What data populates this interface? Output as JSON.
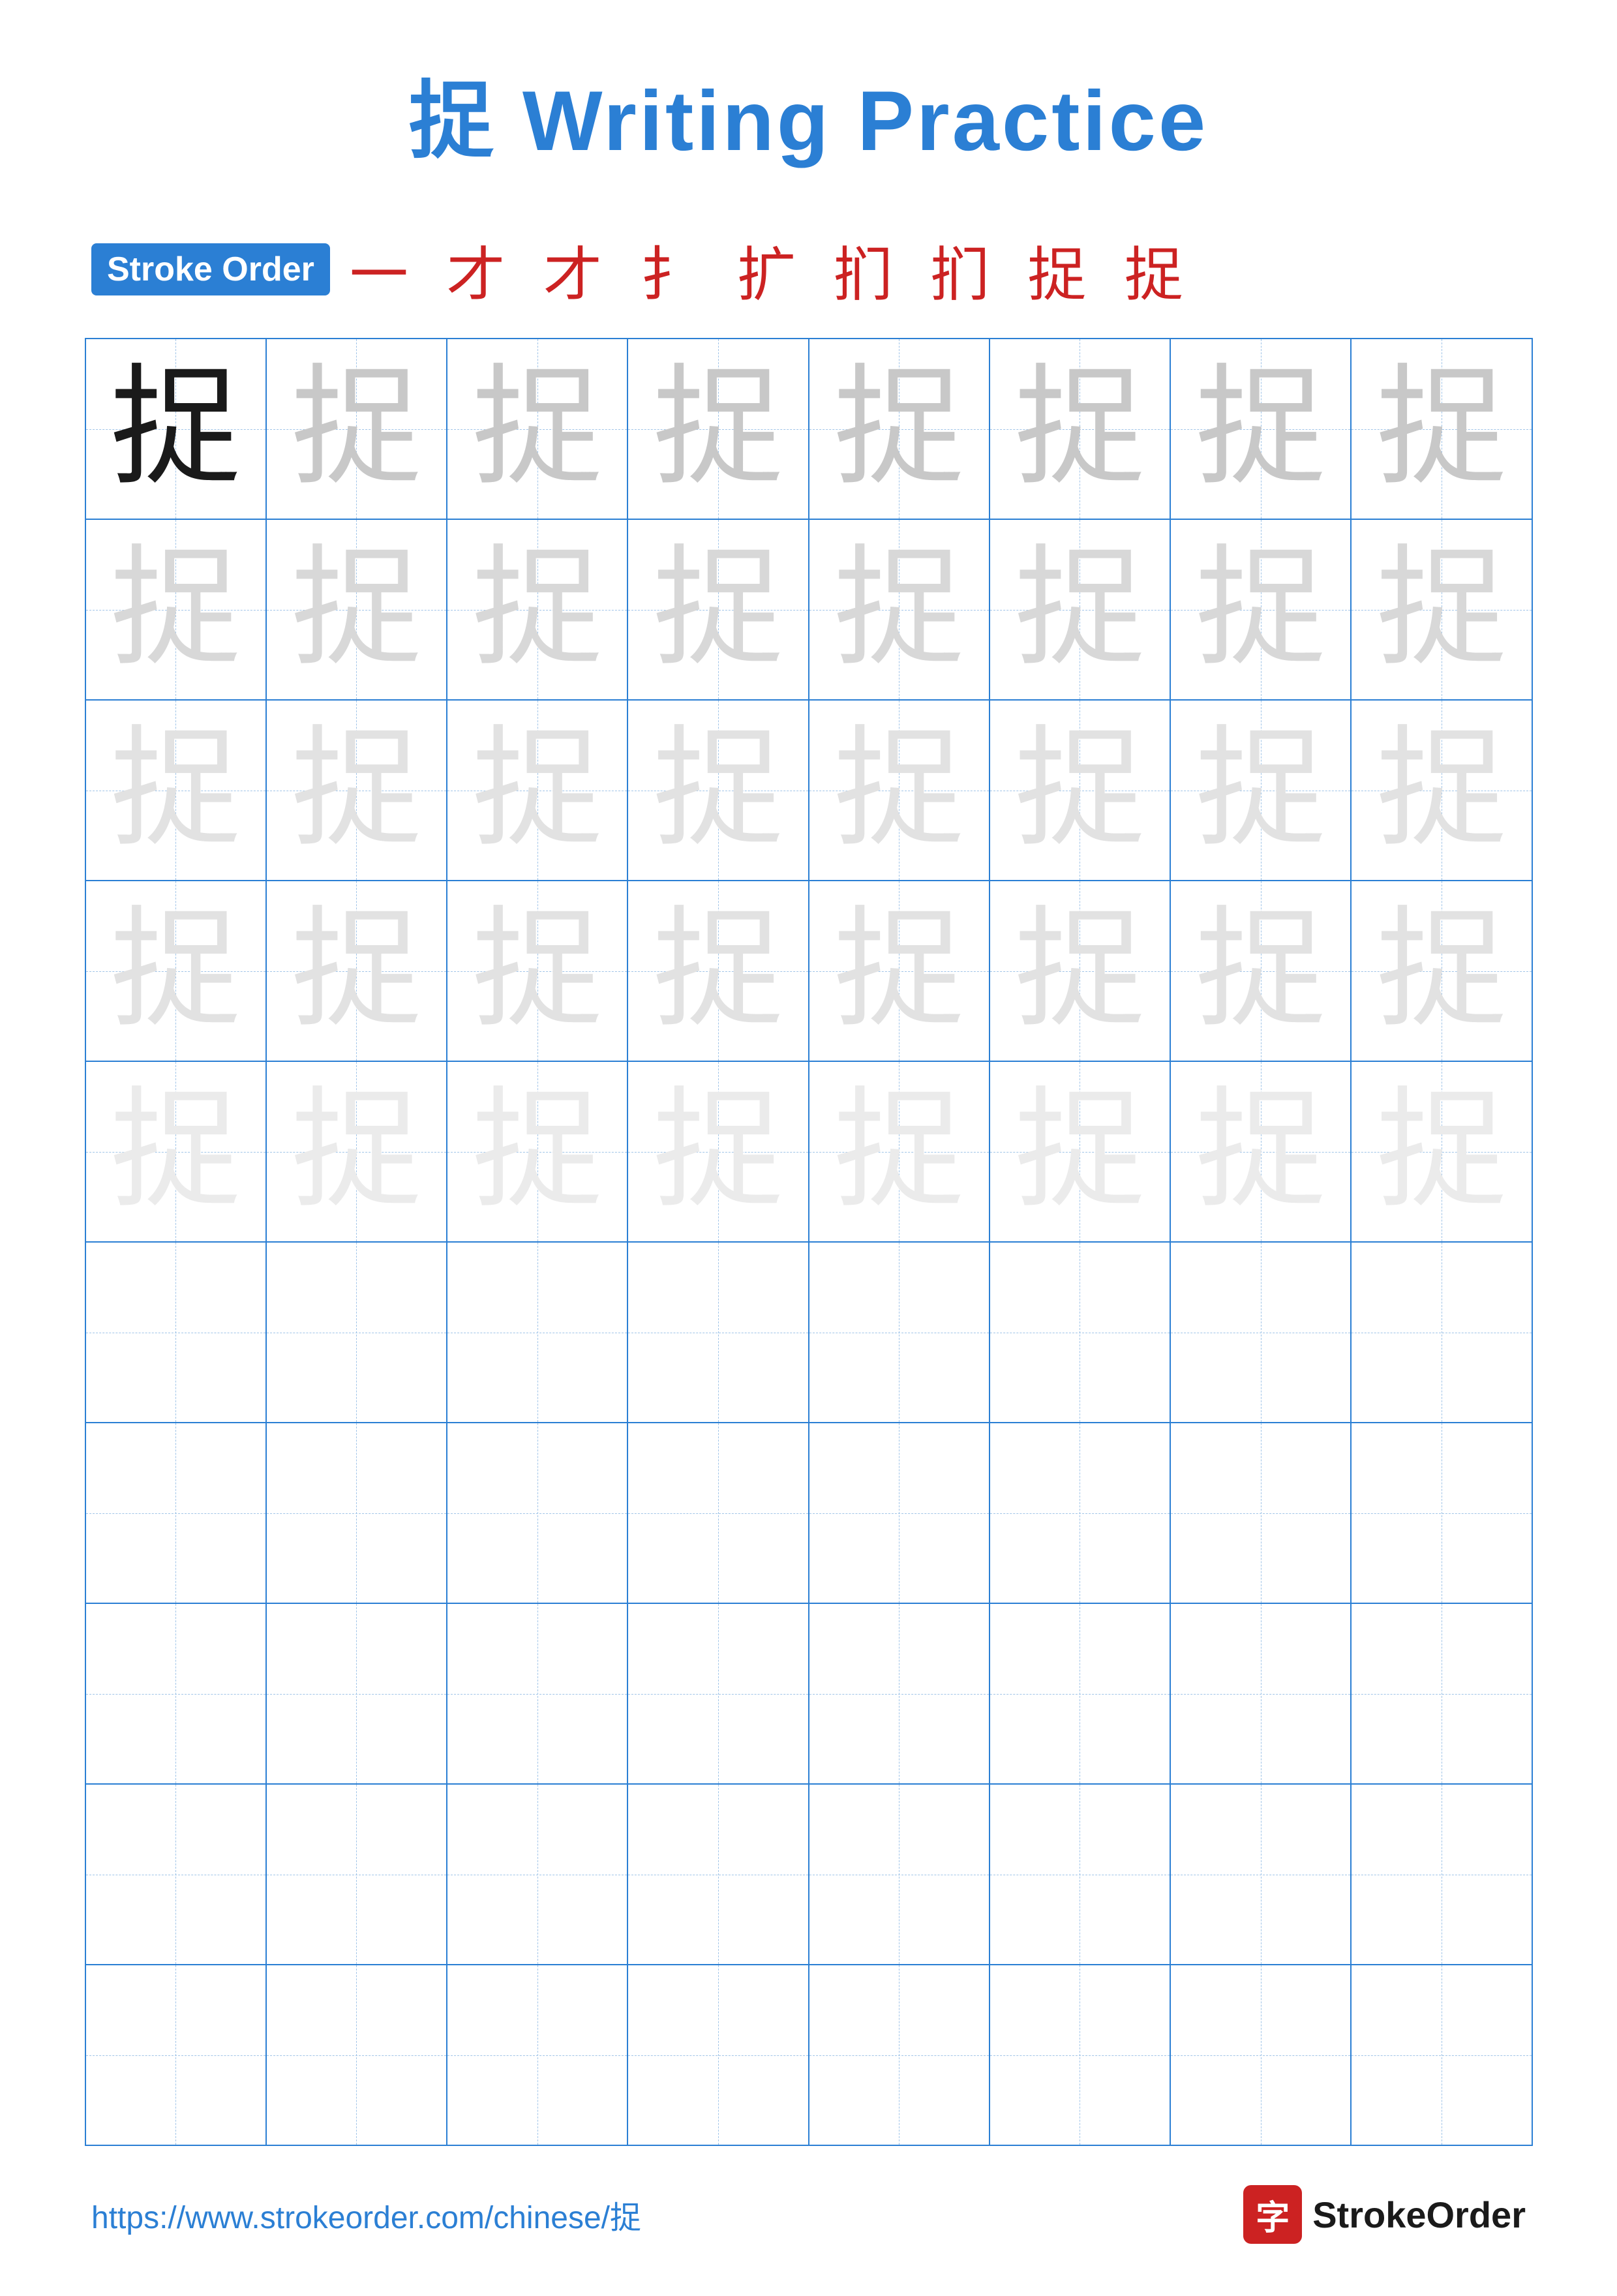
{
  "title": {
    "char": "捉",
    "text": "Writing Practice",
    "full": "捉 Writing Practice"
  },
  "stroke_order": {
    "badge_label": "Stroke Order",
    "chars": "一 才 才 扌 扩 扪 扪 捉 捉"
  },
  "grid": {
    "rows": 10,
    "cols": 8,
    "char": "捉",
    "filled_rows": 5,
    "empty_rows": 5
  },
  "footer": {
    "url": "https://www.strokeorder.com/chinese/捉",
    "logo_char": "字",
    "logo_text": "StrokeOrder"
  }
}
